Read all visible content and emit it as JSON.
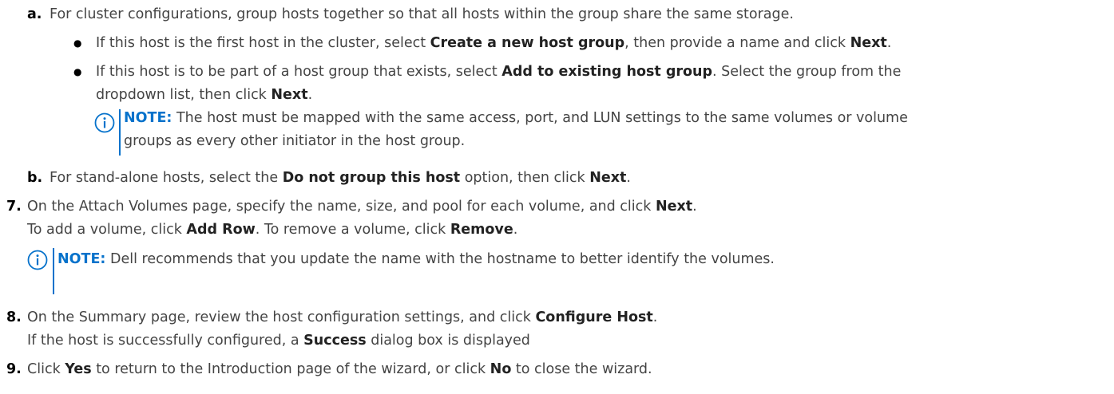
{
  "steps": {
    "a": {
      "marker": "a.",
      "text": "For cluster configurations, group hosts together so that all hosts within the group share the same storage.",
      "bullets": [
        {
          "pre": "If this host is the first host in the cluster, select ",
          "b1": "Create a new host group",
          "mid": ", then provide a name and click ",
          "b2": "Next",
          "post": "."
        },
        {
          "pre": "If this host is to be part of a host group that exists, select ",
          "b1": "Add to existing host group",
          "mid": ". Select the group from the",
          "cont_pre": "dropdown list, then click ",
          "cont_b": "Next",
          "cont_post": "."
        }
      ],
      "note": {
        "label": "NOTE:",
        "line1": " The host must be mapped with the same access, port, and LUN settings to the same volumes or volume",
        "line2": "groups as every other initiator in the host group."
      }
    },
    "b": {
      "marker": "b.",
      "pre": "For stand-alone hosts, select the ",
      "b1": "Do not group this host",
      "mid": " option, then click ",
      "b2": "Next",
      "post": "."
    },
    "s7": {
      "marker": "7.",
      "pre": "On the Attach Volumes page, specify the name, size, and pool for each volume, and click ",
      "b1": "Next",
      "post": ".",
      "l2_pre": "To add a volume, click ",
      "l2_b1": "Add Row",
      "l2_mid": ". To remove a volume, click ",
      "l2_b2": "Remove",
      "l2_post": ".",
      "note": {
        "label": "NOTE:",
        "text": " Dell recommends that you update the name with the hostname to better identify the volumes."
      }
    },
    "s8": {
      "marker": "8.",
      "pre": "On the Summary page, review the host configuration settings, and click ",
      "b1": "Configure Host",
      "post": ".",
      "l2_pre": "If the host is successfully configured, a ",
      "l2_b1": "Success",
      "l2_post": " dialog box is displayed"
    },
    "s9": {
      "marker": "9.",
      "pre": "Click ",
      "b1": "Yes",
      "mid": " to return to the Introduction page of the wizard, or click ",
      "b2": "No",
      "post": " to close the wizard."
    }
  }
}
